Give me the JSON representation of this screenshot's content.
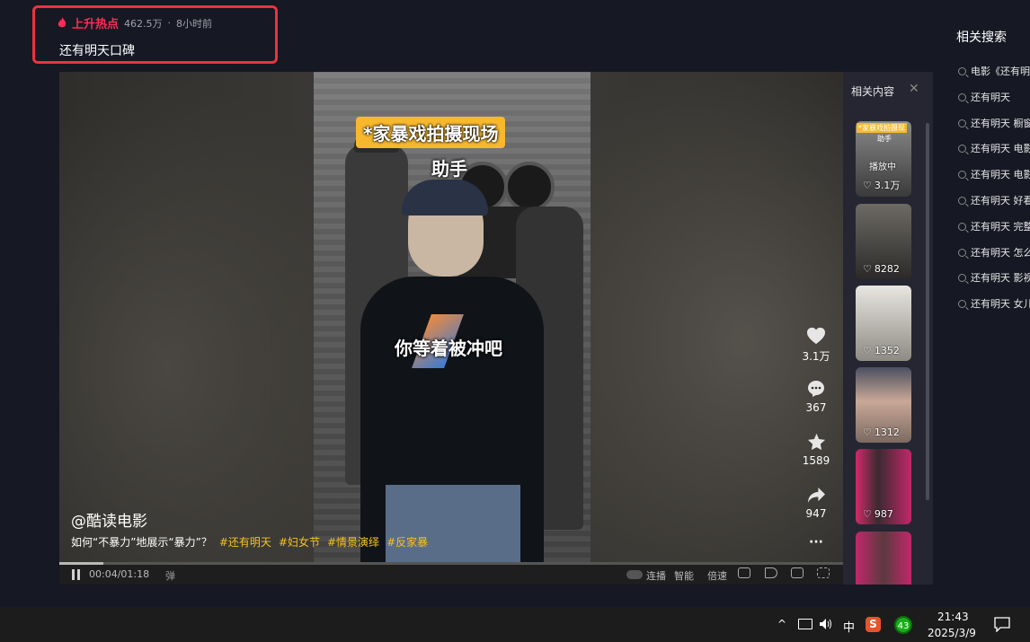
{
  "hot": {
    "label": "上升热点",
    "count": "462.5万",
    "separator": "·",
    "time": "8小时前",
    "title": "还有明天口碑"
  },
  "related_search": {
    "title": "相关搜索",
    "items": [
      "电影《还有明",
      "还有明天",
      "还有明天 橱窗",
      "还有明天 电影",
      "还有明天 电影",
      "还有明天 好看",
      "还有明天 完整",
      "还有明天 怎么",
      "还有明天 影视",
      "还有明天 女儿"
    ]
  },
  "video": {
    "caption_top": "*家暴戏拍摄现场",
    "caption_assist": "助手",
    "caption_mid": "你等着被冲吧",
    "author": "@酷读电影",
    "desc": "如何“不暴力”地展示“暴力”？",
    "tags": [
      "#还有明天",
      "#妇女节",
      "#情景演绎",
      "#反家暴"
    ],
    "progress": 0.056
  },
  "actions": {
    "likes": "3.1万",
    "comments": "367",
    "favorites": "1589",
    "shares": "947",
    "more": "···"
  },
  "controls": {
    "time": "00:04/01:18",
    "barrage": "弹",
    "autoplay": "连播",
    "smart": "智能",
    "speed": "倍速"
  },
  "related_content": {
    "title": "相关内容",
    "close": "✕",
    "items": [
      {
        "likes": "3.1万",
        "playing": "播放中",
        "top_text": "*家暴戏拍摄现",
        "sub_text": "助手"
      },
      {
        "likes": "8282"
      },
      {
        "likes": "1352"
      },
      {
        "likes": "1312"
      },
      {
        "likes": "987"
      },
      {
        "likes": ""
      }
    ]
  },
  "taskbar": {
    "caret": "^",
    "ime": "中",
    "sogou": "S",
    "badge": "43",
    "time": "21:43",
    "date": "2025/3/9"
  },
  "colors": {
    "bg": "#161823",
    "hot_red": "#fe2c55",
    "tag_yellow": "#f7c21c",
    "caption_yellow": "#f7b82e"
  }
}
